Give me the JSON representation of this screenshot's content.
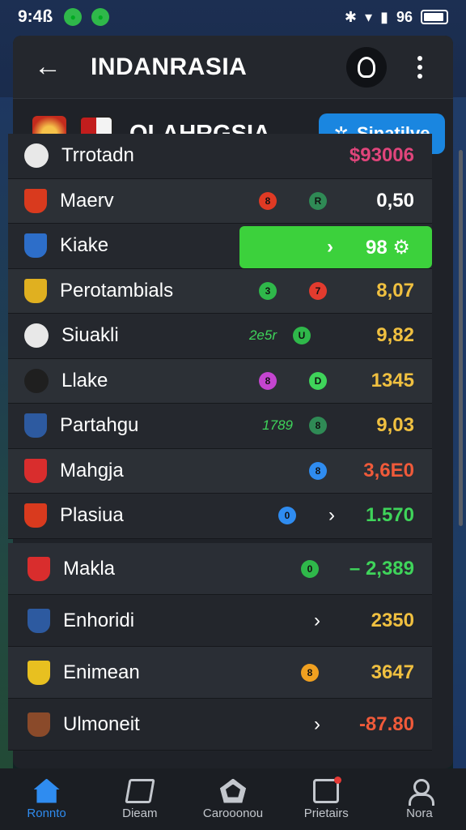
{
  "status_bar": {
    "time": "9:4ß",
    "right_text": "96"
  },
  "header": {
    "title": "INDANRASIA"
  },
  "league": {
    "name": "OLAHRGSIA",
    "action_label": "Sinatilve"
  },
  "rows": [
    {
      "name": "Trrotadn",
      "value": "$93006",
      "value_color": "#e0457b",
      "badge_color": "#e8e8e8",
      "c1": "",
      "c1_color": "",
      "c2": "",
      "c2_color": "",
      "mid": "",
      "chevron": false
    },
    {
      "name": "Maerv",
      "value": "0,50",
      "value_color": "#ffffff",
      "badge_color": "#d93a1e",
      "c1": "8",
      "c1_color": "#e03a24",
      "c2": "R",
      "c2_color": "#2f8a55",
      "mid": "",
      "chevron": false
    },
    {
      "name": "Kiake",
      "value": "",
      "value_color": "#ffffff",
      "badge_color": "#2d6ec9",
      "c1": "",
      "c1_color": "",
      "c2": "",
      "c2_color": "",
      "mid": "",
      "chevron": false,
      "highlight_value": "98 ⚙"
    },
    {
      "name": "Perotambials",
      "value": "8,07",
      "value_color": "#f0c040",
      "badge_color": "#e0b020",
      "c1": "3",
      "c1_color": "#2fb84a",
      "c2": "7",
      "c2_color": "#e33b2e",
      "mid": "",
      "chevron": false
    },
    {
      "name": "Siuakli",
      "value": "9,82",
      "value_color": "#f0c040",
      "badge_color": "#e8e8e8",
      "c1": "U",
      "c1_color": "#2fb84a",
      "c2": "",
      "c2_color": "",
      "mid": "2e5r",
      "chevron": false
    },
    {
      "name": "Llake",
      "value": "1345",
      "value_color": "#f0c040",
      "badge_color": "#1f1f1f",
      "c1": "8",
      "c1_color": "#c445d0",
      "c2": "D",
      "c2_color": "#3fd45a",
      "mid": "",
      "chevron": false
    },
    {
      "name": "Partahgu",
      "value": "9,03",
      "value_color": "#f0c040",
      "badge_color": "#2d5aa0",
      "c1": "",
      "c1_color": "",
      "c2": "8",
      "c2_color": "#2f8a55",
      "mid": "1789",
      "chevron": false
    },
    {
      "name": "Mahgja",
      "value": "3,6E0",
      "value_color": "#f05a3a",
      "badge_color": "#d92d2d",
      "c1": "",
      "c1_color": "",
      "c2": "8",
      "c2_color": "#2f8cf0",
      "mid": "",
      "chevron": false
    },
    {
      "name": "Plasiua",
      "value": "1.570",
      "value_color": "#3fd45a",
      "badge_color": "#d93a1e",
      "c1": "0",
      "c1_color": "#2f8cf0",
      "c2": "",
      "c2_color": "",
      "mid": "",
      "chevron": true
    }
  ],
  "rows2": [
    {
      "name": "Makla",
      "value": "– 2,389",
      "value_color": "#3fd45a",
      "badge_color": "#d92d2d",
      "c": "0",
      "c_color": "#2fb84a",
      "chevron": false
    },
    {
      "name": "Enhoridi",
      "value": "2350",
      "value_color": "#f0c040",
      "badge_color": "#2d5aa0",
      "c": "",
      "c_color": "",
      "chevron": true
    },
    {
      "name": "Enimean",
      "value": "3647",
      "value_color": "#f0c040",
      "badge_color": "#e8c020",
      "c": "8",
      "c_color": "#f0a020",
      "chevron": false
    },
    {
      "name": "Ulmoneit",
      "value": "-87.80",
      "value_color": "#f05a3a",
      "badge_color": "#8a4a2a",
      "c": "",
      "c_color": "",
      "chevron": true
    }
  ],
  "nav": [
    {
      "label": "Ronnto",
      "icon": "home-icon",
      "active": true
    },
    {
      "label": "Dieam",
      "icon": "book-icon",
      "active": false
    },
    {
      "label": "Carooonou",
      "icon": "house-icon",
      "active": false
    },
    {
      "label": "Prietairs",
      "icon": "ticket-icon",
      "active": false
    },
    {
      "label": "Nora",
      "icon": "person-icon",
      "active": false
    }
  ]
}
